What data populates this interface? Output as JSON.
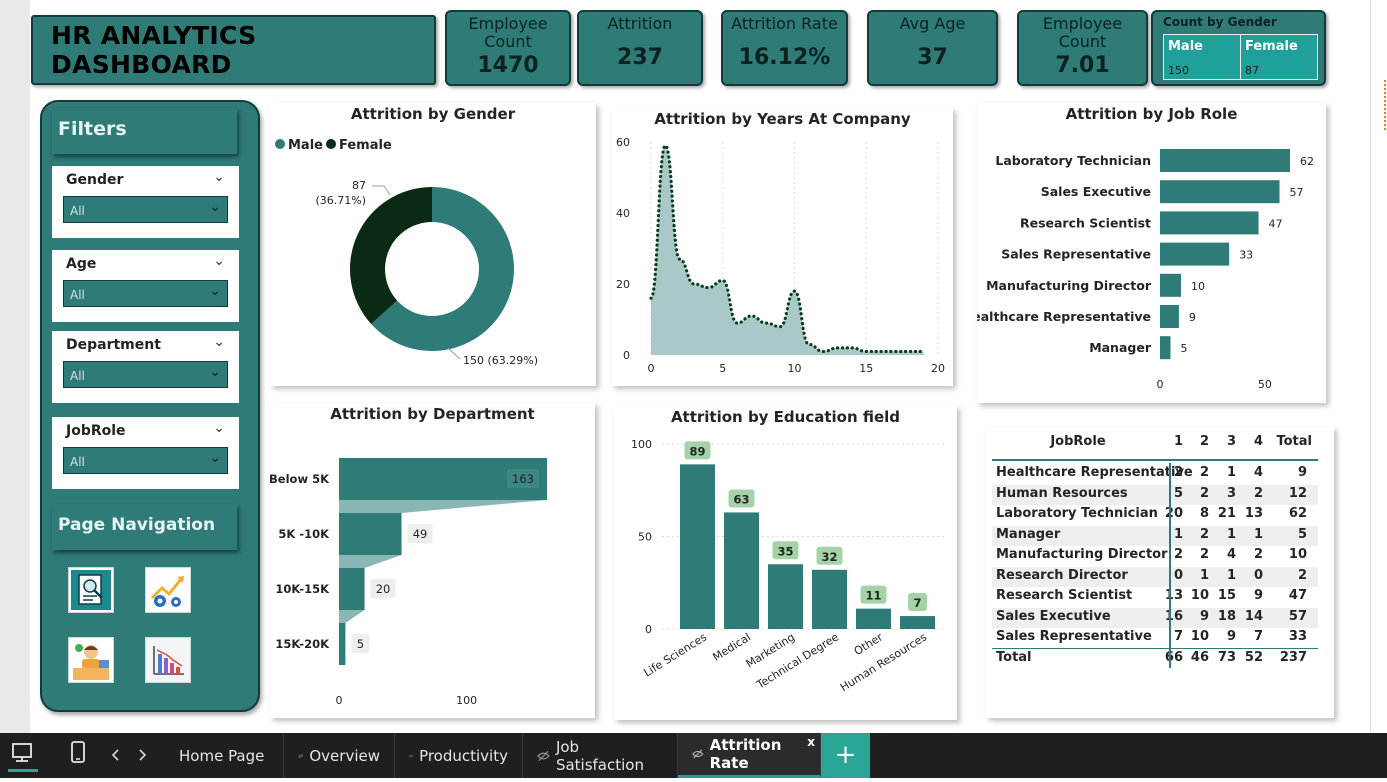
{
  "dashboard_title": "HR ANALYTICS DASHBOARD",
  "kpis": [
    {
      "label": "Employee Count",
      "value": "1470"
    },
    {
      "label": "Attrition",
      "value": "237"
    },
    {
      "label": "Attrition Rate",
      "value": "16.12%"
    },
    {
      "label": "Avg Age",
      "value": "37"
    },
    {
      "label": "Employee Count",
      "value": "7.01"
    }
  ],
  "gender_card": {
    "title": "Count by Gender",
    "male_label": "Male",
    "female_label": "Female",
    "male_value": "150",
    "female_value": "87"
  },
  "filters": {
    "title": "Filters",
    "slicers": [
      {
        "label": "Gender",
        "value": "All"
      },
      {
        "label": "Age",
        "value": "All"
      },
      {
        "label": "Department",
        "value": "All"
      },
      {
        "label": "JobRole",
        "value": "All"
      }
    ]
  },
  "page_navigation": {
    "title": "Page Navigation",
    "icons": [
      "report-analysis-icon",
      "growth-chart-gear-icon",
      "employee-desk-icon",
      "bar-chart-decline-icon"
    ]
  },
  "colors": {
    "teal": "#2e7b78",
    "dark_green": "#0b2a14",
    "area_fill": "#a9c9c9",
    "dots": "#0b3d1d",
    "label_bg": "#a4d3a8"
  },
  "chart_data": [
    {
      "type": "pie",
      "title": "Attrition by Gender",
      "legend": [
        "Male",
        "Female"
      ],
      "legend_position": "top-left",
      "slices": [
        {
          "name": "Male",
          "value": 150,
          "label": "150 (63.29%)"
        },
        {
          "name": "Female",
          "value": 87,
          "label_value": "87",
          "label_pct": "(36.71%)"
        }
      ]
    },
    {
      "type": "area",
      "title": "Attrition by Years At Company",
      "ylim": [
        0,
        60
      ],
      "xlim": [
        0,
        20
      ],
      "y_ticks": [
        "60",
        "40",
        "20",
        "0"
      ],
      "x_ticks": [
        "0",
        "5",
        "10",
        "15",
        "20"
      ],
      "x": [
        0,
        1,
        2,
        3,
        4,
        5,
        6,
        7,
        8,
        9,
        10,
        11,
        12,
        13,
        14,
        15,
        16,
        17,
        18,
        19
      ],
      "y": [
        16,
        59,
        27,
        20,
        19,
        21,
        9,
        11,
        9,
        8,
        18,
        3,
        1,
        2,
        2,
        1,
        1,
        1,
        1,
        1
      ]
    },
    {
      "type": "bar",
      "orientation": "horizontal",
      "title": "Attrition by Job Role",
      "categories": [
        "Laboratory Technician",
        "Sales Executive",
        "Research Scientist",
        "Sales Representative",
        "Manufacturing Director",
        "Healthcare Representative",
        "Manager"
      ],
      "values": [
        62,
        57,
        47,
        33,
        10,
        9,
        5
      ],
      "x_ticks": [
        "0",
        "50"
      ],
      "xlim": [
        0,
        62
      ]
    },
    {
      "type": "bar",
      "orientation": "horizontal",
      "title": "Attrition by Department",
      "categories": [
        "Below 5K",
        "5K -10K",
        "10K-15K",
        "15K-20K"
      ],
      "values": [
        163,
        49,
        20,
        5
      ],
      "x_ticks": [
        "0",
        "100"
      ],
      "xlim": [
        0,
        163
      ]
    },
    {
      "type": "bar",
      "title": "Attrition by Education field",
      "categories": [
        "Life Sciences",
        "Medical",
        "Marketing",
        "Technical Degree",
        "Other",
        "Human Resources"
      ],
      "values": [
        89,
        63,
        35,
        32,
        11,
        7
      ],
      "y_ticks": [
        "100",
        "50",
        "0"
      ],
      "ylim": [
        0,
        100
      ]
    },
    {
      "type": "table",
      "columns": [
        "JobRole",
        "1",
        "2",
        "3",
        "4",
        "Total"
      ],
      "rows": [
        [
          "Healthcare Representative",
          "2",
          "2",
          "1",
          "4",
          "9"
        ],
        [
          "Human Resources",
          "5",
          "2",
          "3",
          "2",
          "12"
        ],
        [
          "Laboratory Technician",
          "20",
          "8",
          "21",
          "13",
          "62"
        ],
        [
          "Manager",
          "1",
          "2",
          "1",
          "1",
          "5"
        ],
        [
          "Manufacturing Director",
          "2",
          "2",
          "4",
          "2",
          "10"
        ],
        [
          "Research Director",
          "0",
          "1",
          "1",
          "0",
          "2"
        ],
        [
          "Research Scientist",
          "13",
          "10",
          "15",
          "9",
          "47"
        ],
        [
          "Sales Executive",
          "16",
          "9",
          "18",
          "14",
          "57"
        ],
        [
          "Sales Representative",
          "7",
          "10",
          "9",
          "7",
          "33"
        ]
      ],
      "total_row": [
        "Total",
        "66",
        "46",
        "73",
        "52",
        "237"
      ]
    }
  ],
  "taskbar": {
    "tabs": [
      "Home Page",
      "Overview",
      "Productivity",
      "Job Satisfaction",
      "Attrition Rate"
    ],
    "active_tab": "Attrition Rate",
    "close_glyph": "x",
    "add_glyph": "+"
  }
}
